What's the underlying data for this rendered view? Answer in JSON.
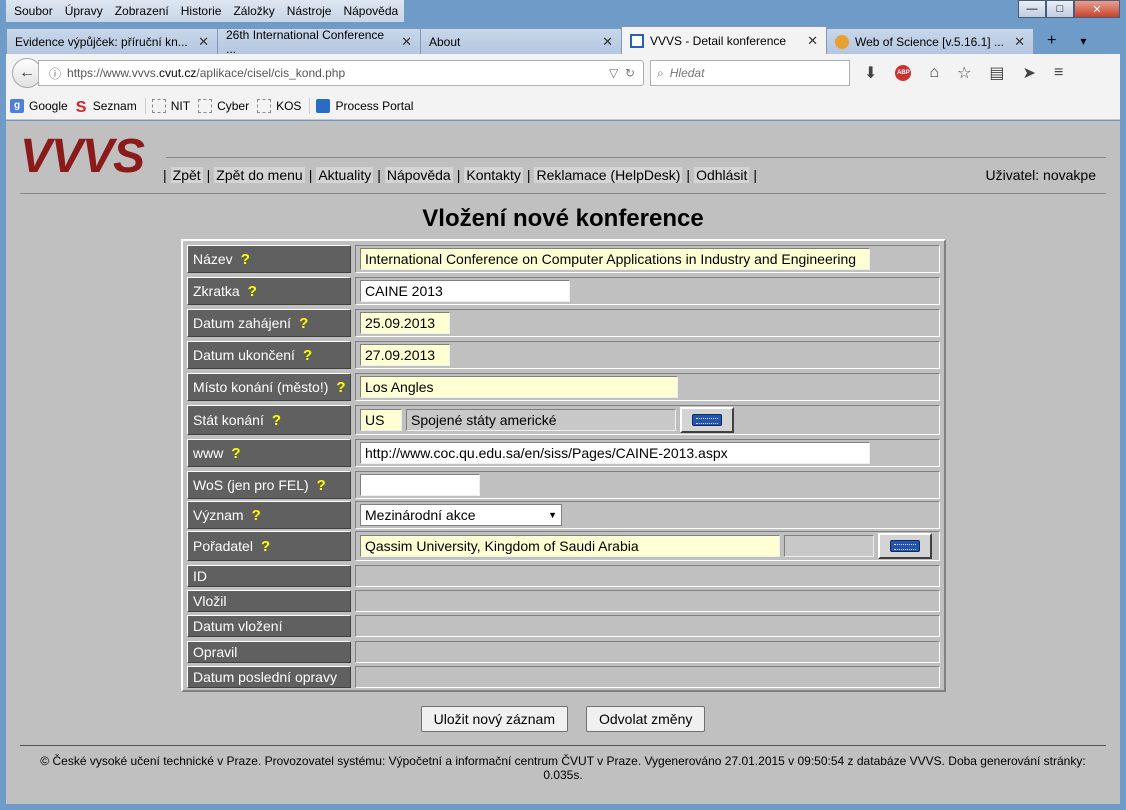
{
  "menu": [
    "Soubor",
    "Úpravy",
    "Zobrazení",
    "Historie",
    "Záložky",
    "Nástroje",
    "Nápověda"
  ],
  "window_controls": {
    "minimize": "—",
    "maximize": "□",
    "close": "✕"
  },
  "tabs": [
    {
      "label": "Evidence výpůjček: příruční kn...",
      "active": false
    },
    {
      "label": "26th International Conference ...",
      "active": false
    },
    {
      "label": "About",
      "active": false
    },
    {
      "label": "VVVS - Detail konference",
      "active": true
    },
    {
      "label": "Web of Science [v.5.16.1] ...",
      "active": false
    }
  ],
  "tab_new": "+",
  "tab_list": "▾",
  "url": {
    "prefix": "https://www.vvvs.",
    "domain": "cvut.cz",
    "path": "/aplikace/cisel/cis_kond.php"
  },
  "search_placeholder": "Hledat",
  "bookmarks": [
    {
      "label": "Google",
      "icon": "google-icon"
    },
    {
      "label": "Seznam",
      "icon": "seznam-icon"
    },
    {
      "label": "NIT",
      "icon": "folder-icon"
    },
    {
      "label": "Cyber",
      "icon": "folder-icon"
    },
    {
      "label": "KOS",
      "icon": "folder-icon"
    },
    {
      "label": "Process Portal",
      "icon": "process-portal-icon"
    }
  ],
  "site": {
    "logo": "VVVS",
    "nav": [
      "Zpět",
      "Zpět do menu",
      "Aktuality",
      "Nápověda",
      "Kontakty",
      "Reklamace (HelpDesk)",
      "Odhlásit"
    ],
    "user": "Uživatel: novakpe",
    "title": "Vložení nové konference"
  },
  "form": {
    "nazev_label": "Název",
    "nazev_value": "International Conference on Computer Applications in Industry and Engineering",
    "zkratka_label": "Zkratka",
    "zkratka_value": "CAINE 2013",
    "datum_zahajeni_label": "Datum zahájení",
    "datum_zahajeni_value": "25.09.2013",
    "datum_ukonceni_label": "Datum ukončení",
    "datum_ukonceni_value": "27.09.2013",
    "misto_label": "Místo konání (město!)",
    "misto_value": "Los Angles",
    "stat_label": "Stát konání",
    "stat_code": "US",
    "stat_name": "Spojené státy americké",
    "www_label": "www",
    "www_value": "http://www.coc.qu.edu.sa/en/siss/Pages/CAINE-2013.aspx",
    "wos_label": "WoS (jen pro FEL)",
    "wos_value": "",
    "vyznam_label": "Význam",
    "vyznam_value": "Mezinárodní akce",
    "poradatel_label": "Pořadatel",
    "poradatel_value": "Qassim University, Kingdom of Saudi Arabia",
    "id_label": "ID",
    "vlozil_label": "Vložil",
    "datum_vlozeni_label": "Datum vložení",
    "opravil_label": "Opravil",
    "datum_posledni_opravy_label": "Datum poslední opravy",
    "help_mark": "?"
  },
  "buttons": {
    "save": "Uložit nový záznam",
    "cancel": "Odvolat změny"
  },
  "footer": "© České vysoké učení technické v Praze. Provozovatel systému: Výpočetní a informační centrum ČVUT v Praze. Vygenerováno 27.01.2015 v 09:50:54 z databáze VVVS. Doba generování stránky: 0.035s."
}
